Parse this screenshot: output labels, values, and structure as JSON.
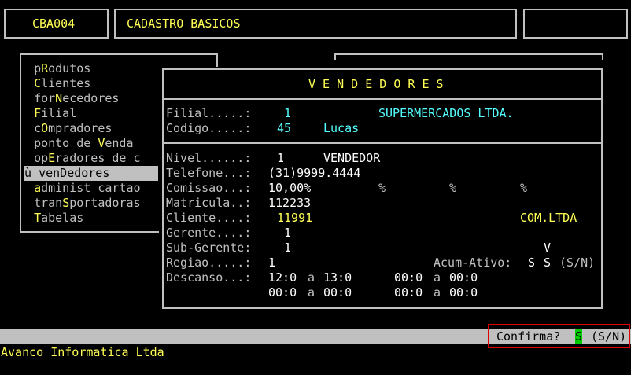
{
  "header": {
    "program_code": "CBA004",
    "screen_title": "CADASTRO BASICOS"
  },
  "menu": {
    "items": [
      {
        "pre": "p",
        "hot": "R",
        "post": "odutos"
      },
      {
        "pre": "",
        "hot": "C",
        "post": "lientes"
      },
      {
        "pre": "for",
        "hot": "N",
        "post": "ecedores"
      },
      {
        "pre": "",
        "hot": "F",
        "post": "ilial"
      },
      {
        "pre": "c",
        "hot": "O",
        "post": "mpradores"
      },
      {
        "pre": "ponto de ",
        "hot": "V",
        "post": "enda"
      },
      {
        "pre": "op",
        "hot": "E",
        "post": "radores de c"
      },
      {
        "pre": "ven",
        "hot": "D",
        "post": "edores",
        "marker": "ù "
      },
      {
        "pre": "",
        "hot": "a",
        "post": "dminist cartao"
      },
      {
        "pre": "tran",
        "hot": "S",
        "post": "portadoras"
      },
      {
        "pre": "",
        "hot": "T",
        "post": "abelas"
      }
    ]
  },
  "vendedores": {
    "title": "V E N D E D O R E S",
    "filial_label": "Filial.....:",
    "filial_value": "1",
    "filial_name": "SUPERMERCADOS LTDA.",
    "codigo_label": "Codigo.....:",
    "codigo_value": "45",
    "codigo_name": "Lucas",
    "nivel_label": "Nivel......:",
    "nivel_value": "1",
    "nivel_desc": "VENDEDOR",
    "telefone_label": "Telefone...:",
    "telefone_value": "(31)9999.4444",
    "comissao_label": "Comissao...:",
    "comissao_value": "10,00%",
    "pct": "%",
    "matricula_label": "Matricula..:",
    "matricula_value": "112233",
    "cliente_label": "Cliente....:",
    "cliente_value": "11991",
    "cliente_name": "COM.LTDA",
    "gerente_label": "Gerente....:",
    "gerente_value": "1",
    "subgerente_label": "Sub-Gerente:",
    "subgerente_value": "1",
    "subgerente_flag": "V",
    "regiao_label": "Regiao.....:",
    "regiao_value": "1",
    "acum_label": "Acum-Ativo:",
    "acum_v1": "S",
    "acum_v2": "S",
    "acum_hint": "(S/N)",
    "descanso_label": "Descanso...:",
    "desc_r1_a_from": "12:0",
    "desc_r1_a_to": "13:0",
    "desc_r1_b_from": "00:0",
    "desc_r1_b_to": "00:0",
    "desc_r2_a_from": "00:0",
    "desc_r2_a_to": "00:0",
    "desc_r2_b_from": "00:0",
    "desc_r2_b_to": "00:0",
    "sep": "a"
  },
  "status": {
    "confirm_label": "Confirma?",
    "confirm_value": "S",
    "confirm_hint": "(S/N)"
  },
  "footer": {
    "company": "Avanco Informatica Ltda"
  },
  "colors": {
    "background": "#000000",
    "foreground": "#c0c0c0",
    "yellow": "#ffff55",
    "cyan": "#55ffff",
    "highlight_red": "#e00000",
    "cursor_green": "#00cc00"
  }
}
